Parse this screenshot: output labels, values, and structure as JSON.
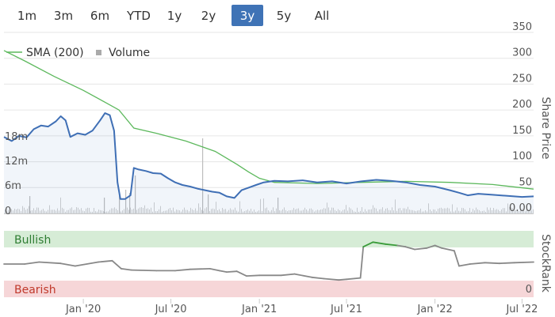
{
  "range_selector": {
    "buttons": [
      "1m",
      "3m",
      "6m",
      "YTD",
      "1y",
      "2y",
      "3y",
      "5y",
      "All"
    ],
    "selected": "3y",
    "active_color": "#3f73b6"
  },
  "legend": {
    "sma_label": "SMA (200)",
    "volume_label": "Volume",
    "sma_color": "#5cb85c",
    "volume_color": "#aaaaaa"
  },
  "chart_data": [
    {
      "type": "line",
      "title": "",
      "ylabel": "Share Price",
      "ylim": [
        0,
        350
      ],
      "y_ticks": [
        "350",
        "300",
        "250",
        "200",
        "150",
        "100",
        "50",
        "0.00"
      ],
      "x_ticks": [
        "Jan '20",
        "Jul '20",
        "Jan '21",
        "Jul '21",
        "Jan '22",
        "Jul '22"
      ],
      "xlim": [
        "2019-07-20",
        "2022-07-25"
      ],
      "volume_ticks": [
        "18m",
        "12m",
        "6m",
        "0"
      ],
      "series": [
        {
          "name": "",
          "color": "#3f6fb5",
          "points": [
            [
              "2019-07-20",
              148
            ],
            [
              "2019-08-05",
              140
            ],
            [
              "2019-08-20",
              150
            ],
            [
              "2019-09-05",
              147
            ],
            [
              "2019-09-20",
              163
            ],
            [
              "2019-10-05",
              170
            ],
            [
              "2019-10-20",
              168
            ],
            [
              "2019-11-05",
              178
            ],
            [
              "2019-11-15",
              188
            ],
            [
              "2019-11-25",
              180
            ],
            [
              "2019-12-05",
              148
            ],
            [
              "2019-12-20",
              155
            ],
            [
              "2020-01-05",
              152
            ],
            [
              "2020-01-20",
              160
            ],
            [
              "2020-02-05",
              180
            ],
            [
              "2020-02-15",
              194
            ],
            [
              "2020-02-25",
              190
            ],
            [
              "2020-03-05",
              160
            ],
            [
              "2020-03-12",
              60
            ],
            [
              "2020-03-18",
              28
            ],
            [
              "2020-03-28",
              28
            ],
            [
              "2020-04-08",
              35
            ],
            [
              "2020-04-15",
              88
            ],
            [
              "2020-04-25",
              85
            ],
            [
              "2020-05-10",
              82
            ],
            [
              "2020-05-25",
              78
            ],
            [
              "2020-06-10",
              77
            ],
            [
              "2020-06-25",
              68
            ],
            [
              "2020-07-10",
              60
            ],
            [
              "2020-07-25",
              55
            ],
            [
              "2020-08-10",
              52
            ],
            [
              "2020-08-25",
              48
            ],
            [
              "2020-09-10",
              45
            ],
            [
              "2020-09-25",
              42
            ],
            [
              "2020-10-10",
              40
            ],
            [
              "2020-10-25",
              33
            ],
            [
              "2020-11-10",
              30
            ],
            [
              "2020-11-25",
              45
            ],
            [
              "2020-12-10",
              50
            ],
            [
              "2020-12-25",
              55
            ],
            [
              "2021-01-10",
              60
            ],
            [
              "2021-02-01",
              63
            ],
            [
              "2021-03-01",
              62
            ],
            [
              "2021-04-01",
              64
            ],
            [
              "2021-05-01",
              60
            ],
            [
              "2021-06-01",
              62
            ],
            [
              "2021-07-01",
              58
            ],
            [
              "2021-08-01",
              62
            ],
            [
              "2021-09-01",
              65
            ],
            [
              "2021-10-01",
              63
            ],
            [
              "2021-11-01",
              60
            ],
            [
              "2021-12-01",
              55
            ],
            [
              "2022-01-01",
              52
            ],
            [
              "2022-02-01",
              45
            ],
            [
              "2022-02-20",
              40
            ],
            [
              "2022-03-10",
              35
            ],
            [
              "2022-04-01",
              38
            ],
            [
              "2022-05-01",
              36
            ],
            [
              "2022-06-01",
              34
            ],
            [
              "2022-07-01",
              32
            ],
            [
              "2022-07-25",
              33
            ]
          ]
        },
        {
          "name": "SMA (200)",
          "color": "#5cb85c",
          "points": [
            [
              "2019-07-20",
              315
            ],
            [
              "2019-09-01",
              295
            ],
            [
              "2019-11-01",
              265
            ],
            [
              "2020-01-01",
              238
            ],
            [
              "2020-02-15",
              215
            ],
            [
              "2020-03-15",
              200
            ],
            [
              "2020-04-15",
              165
            ],
            [
              "2020-06-01",
              155
            ],
            [
              "2020-08-01",
              140
            ],
            [
              "2020-10-01",
              120
            ],
            [
              "2020-11-15",
              95
            ],
            [
              "2020-12-10",
              80
            ],
            [
              "2021-01-01",
              68
            ],
            [
              "2021-02-01",
              60
            ],
            [
              "2021-05-01",
              58
            ],
            [
              "2021-08-01",
              60
            ],
            [
              "2021-11-01",
              62
            ],
            [
              "2022-02-01",
              60
            ],
            [
              "2022-05-01",
              56
            ],
            [
              "2022-07-25",
              47
            ]
          ]
        }
      ]
    },
    {
      "type": "line",
      "title": "",
      "ylabel": "StockRank",
      "ylim": [
        0,
        100
      ],
      "y_ticks": [
        "0"
      ],
      "band_labels": {
        "upper": "Bullish",
        "lower": "Bearish"
      },
      "band_colors": {
        "upper": "#d6ecd6",
        "lower": "#f6d6d8"
      },
      "series": [
        {
          "name": "StockRank",
          "color": "#888888",
          "bullish_color": "#3a9c3a",
          "bullish_threshold": 80,
          "points": [
            [
              "2019-07-20",
              50
            ],
            [
              "2019-09-01",
              50
            ],
            [
              "2019-10-01",
              53
            ],
            [
              "2019-11-15",
              51
            ],
            [
              "2019-12-15",
              47
            ],
            [
              "2020-02-01",
              53
            ],
            [
              "2020-03-01",
              55
            ],
            [
              "2020-03-20",
              43
            ],
            [
              "2020-04-10",
              41
            ],
            [
              "2020-06-01",
              40
            ],
            [
              "2020-07-10",
              40
            ],
            [
              "2020-08-10",
              42
            ],
            [
              "2020-09-20",
              43
            ],
            [
              "2020-10-10",
              40
            ],
            [
              "2020-10-25",
              38
            ],
            [
              "2020-11-15",
              39
            ],
            [
              "2020-12-05",
              32
            ],
            [
              "2021-01-01",
              33
            ],
            [
              "2021-02-15",
              33
            ],
            [
              "2021-03-15",
              35
            ],
            [
              "2021-04-20",
              30
            ],
            [
              "2021-05-15",
              28
            ],
            [
              "2021-06-15",
              26
            ],
            [
              "2021-07-01",
              27
            ],
            [
              "2021-07-30",
              29
            ],
            [
              "2021-08-05",
              76
            ],
            [
              "2021-08-25",
              83
            ],
            [
              "2021-09-20",
              80
            ],
            [
              "2021-10-15",
              78
            ],
            [
              "2021-11-01",
              76
            ],
            [
              "2021-11-20",
              72
            ],
            [
              "2021-12-15",
              74
            ],
            [
              "2022-01-01",
              78
            ],
            [
              "2022-01-15",
              74
            ],
            [
              "2022-02-10",
              70
            ],
            [
              "2022-02-20",
              47
            ],
            [
              "2022-03-15",
              50
            ],
            [
              "2022-04-15",
              52
            ],
            [
              "2022-05-15",
              51
            ],
            [
              "2022-06-15",
              52
            ],
            [
              "2022-07-25",
              53
            ]
          ]
        }
      ]
    }
  ]
}
